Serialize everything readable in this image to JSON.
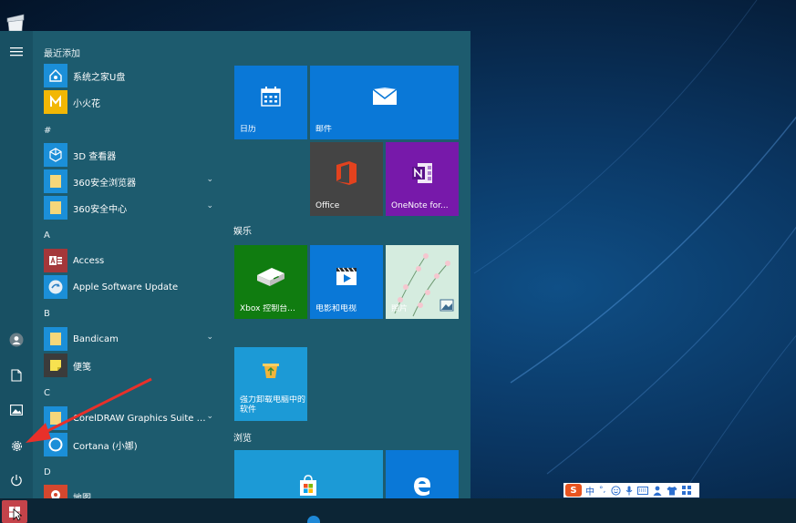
{
  "applist": {
    "recent_header": "最近添加",
    "groups": [
      {
        "letter": "#"
      },
      {
        "letter": "A"
      },
      {
        "letter": "B"
      },
      {
        "letter": "C"
      },
      {
        "letter": "D"
      }
    ],
    "recent": [
      {
        "label": "系统之家U盘",
        "icon": "usb-tool-icon"
      },
      {
        "label": "小火花",
        "icon": "spark-icon"
      }
    ],
    "apps": [
      {
        "label": "3D 查看器",
        "icon": "cube-3d-icon"
      },
      {
        "label": "360安全浏览器",
        "icon": "folder-icon",
        "expand": "⌄"
      },
      {
        "label": "360安全中心",
        "icon": "folder-icon",
        "expand": "⌄"
      },
      {
        "label": "Access",
        "icon": "access-icon"
      },
      {
        "label": "Apple Software Update",
        "icon": "apple-update-icon"
      },
      {
        "label": "Bandicam",
        "icon": "folder-icon",
        "expand": "⌄"
      },
      {
        "label": "便笺",
        "icon": "sticky-notes-icon"
      },
      {
        "label": "CorelDRAW Graphics Suite 20...",
        "icon": "folder-icon",
        "expand": "⌄"
      },
      {
        "label": "Cortana (小娜)",
        "icon": "cortana-icon"
      },
      {
        "label": "地图",
        "icon": "maps-icon"
      }
    ]
  },
  "tiles": {
    "sections": [
      "娱乐",
      "浏览"
    ],
    "items": [
      {
        "label": "日历",
        "color": "#0a78d7"
      },
      {
        "label": "邮件",
        "color": "#0a78d7"
      },
      {
        "label": "Office",
        "color": "#444444"
      },
      {
        "label": "OneNote for...",
        "color": "#7719aa"
      },
      {
        "label": "Xbox 控制台...",
        "color": "#107c10"
      },
      {
        "label": "电影和电视",
        "color": "#0a78d7"
      },
      {
        "label": "照片",
        "color": "#cfe7d8"
      },
      {
        "label": "强力卸载电脑中的软件",
        "color": "#1c9ad6"
      },
      {
        "label": "",
        "color": "#1c9ad6"
      },
      {
        "label": "",
        "color": "#0a78d7"
      }
    ]
  },
  "ime": {
    "logo": "S",
    "mode": "中",
    "punct": "°,"
  }
}
